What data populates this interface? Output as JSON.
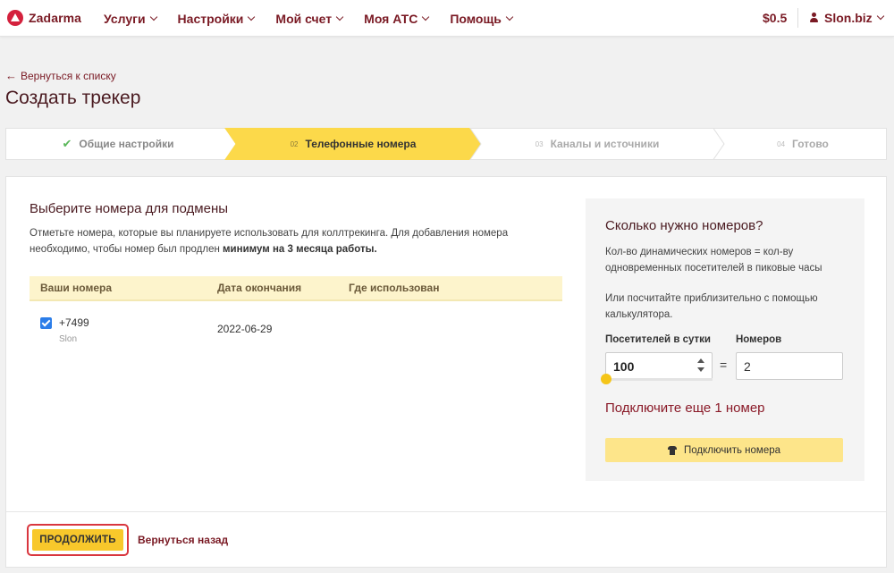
{
  "header": {
    "logo_text": "Zadarma",
    "nav": [
      {
        "label": "Услуги"
      },
      {
        "label": "Настройки"
      },
      {
        "label": "Мой счет"
      },
      {
        "label": "Моя АТС"
      },
      {
        "label": "Помощь"
      }
    ],
    "balance": "$0.5",
    "user": "Slon.biz",
    "accent_color": "#7a1a24"
  },
  "back_link": "Вернуться к списку",
  "page_title": "Создать трекер",
  "stepper": {
    "steps": [
      {
        "num": "",
        "label": "Общие настройки",
        "state": "done"
      },
      {
        "num": "02",
        "label": "Телефонные номера",
        "state": "active"
      },
      {
        "num": "03",
        "label": "Каналы и источники",
        "state": "pending"
      },
      {
        "num": "04",
        "label": "Готово",
        "state": "pending"
      }
    ],
    "active_color": "#fcd94a"
  },
  "section": {
    "title": "Выберите номера для подмены",
    "desc_part1": "Отметьте номера, которые вы планируете использовать для коллтрекинга. Для добавления номера необходимо, чтобы номер был продлен ",
    "desc_bold": "минимум на 3 месяца работы."
  },
  "table": {
    "headers": {
      "numbers": "Ваши номера",
      "date": "Дата окончания",
      "used": "Где использован"
    },
    "rows": [
      {
        "checked": true,
        "phone": "+7499",
        "label": "Slon",
        "expiry": "2022-06-29",
        "used": ""
      }
    ]
  },
  "calc": {
    "title": "Сколько нужно номеров?",
    "text1": "Кол-во динамических номеров = кол-ву одновременных посетителей в пиковые часы",
    "text2": "Или посчитайте приблизительно с помощью калькулятора.",
    "visitors_label": "Посетителей в сутки",
    "numbers_label": "Номеров",
    "visitors_value": "100",
    "equals": "=",
    "numbers_value": "2",
    "slider_level": 0,
    "connect_msg": "Подключите еще 1 номер",
    "connect_btn": "Подключить номера"
  },
  "footer": {
    "continue": "ПРОДОЛЖИТЬ",
    "go_back": "Вернуться назад"
  }
}
